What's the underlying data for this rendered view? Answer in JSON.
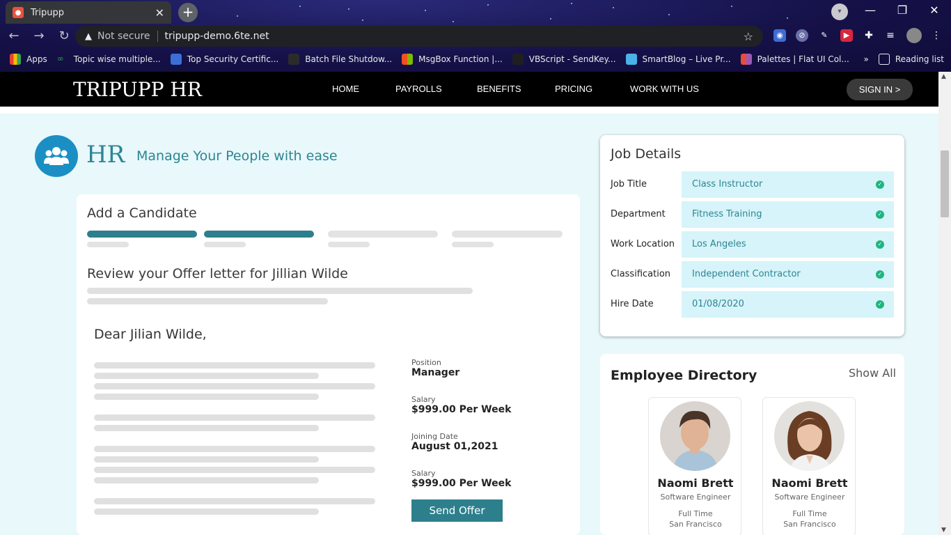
{
  "browser": {
    "tab_title": "Tripupp",
    "tab_close": "✕",
    "new_tab": "+",
    "url_security": "Not secure",
    "url": "tripupp-demo.6te.net",
    "more_bookmarks": "»",
    "bookmarks": [
      {
        "label": "Apps",
        "color": "#e94235"
      },
      {
        "label": "Topic wise multiple...",
        "color": "#2e9b4e"
      },
      {
        "label": "Top Security Certific...",
        "color": "#3b6fd6"
      },
      {
        "label": "Batch File Shutdow...",
        "color": "#2b2b2b"
      },
      {
        "label": "MsgBox Function |...",
        "color": "#f25022"
      },
      {
        "label": "VBScript - SendKey...",
        "color": "#1f1f1f"
      },
      {
        "label": "SmartBlog – Live Pr...",
        "color": "#4ab2e8"
      },
      {
        "label": "Palettes | Flat UI Col...",
        "color": "#e84c3d"
      }
    ],
    "reading_list": "Reading list"
  },
  "site": {
    "brand": "TRIPUPP HR",
    "nav": [
      "HOME",
      "PAYROLLS",
      "BENEFITS",
      "PRICING",
      "WORK WITH US"
    ],
    "signin": "SIGN IN >"
  },
  "hero": {
    "title": "HR",
    "tagline": "Manage Your People with ease"
  },
  "candidate": {
    "heading": "Add a Candidate",
    "steps_completed": 2,
    "steps_total": 4,
    "review_heading": "Review your Offer letter for Jillian Wilde",
    "greeting": "Dear Jilian Wilde,",
    "fields": [
      {
        "label": "Position",
        "value": "Manager"
      },
      {
        "label": "Salary",
        "value": "$999.00 Per Week"
      },
      {
        "label": "Joining Date",
        "value": "August 01,2021"
      },
      {
        "label": "Salary",
        "value": "$999.00 Per Week"
      }
    ],
    "send_button": "Send Offer"
  },
  "job_details": {
    "heading": "Job Details",
    "rows": [
      {
        "label": "Job Title",
        "value": "Class Instructor"
      },
      {
        "label": "Department",
        "value": "Fitness Training"
      },
      {
        "label": "Work Location",
        "value": "Los Angeles"
      },
      {
        "label": "Classification",
        "value": "Independent Contractor"
      },
      {
        "label": "Hire Date",
        "value": "01/08/2020"
      }
    ]
  },
  "directory": {
    "heading": "Employee Directory",
    "show_all": "Show All",
    "employees": [
      {
        "name": "Naomi Brett",
        "role": "Software Engineer",
        "type": "Full Time",
        "location": "San Francisco"
      },
      {
        "name": "Naomi Brett",
        "role": "Software Engineer",
        "type": "Full Time",
        "location": "San Francisco"
      }
    ]
  },
  "colors": {
    "accent": "#2d8592",
    "step_active": "#2d7f8c",
    "step_inactive": "#e3e3e3",
    "page_bg": "#e8f8fb",
    "field_bg": "#d6f4fa",
    "check": "#1fb57f",
    "hr_icon": "#1b8fc4"
  }
}
